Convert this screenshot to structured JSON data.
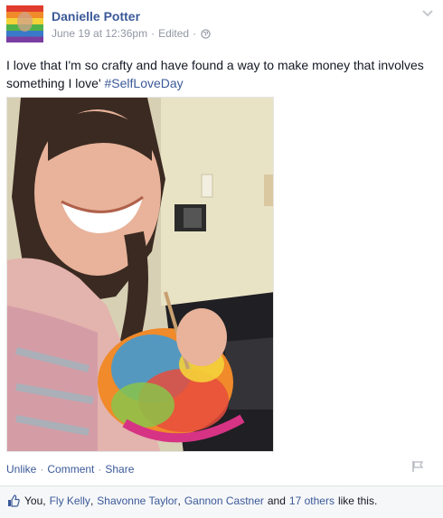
{
  "post": {
    "author": "Danielle Potter",
    "date": "June 19 at 12:36pm",
    "separator": "·",
    "edited": "Edited",
    "message": "I love that I'm so crafty and have found a way to make money that involves something I love'",
    "hashtag": "#SelfLoveDay"
  },
  "actions": {
    "unlike": "Unlike",
    "comment": "Comment",
    "share": "Share",
    "dot": "·"
  },
  "likes": {
    "you": "You",
    "comma1": ",",
    "name1": "Fly Kelly",
    "comma2": ",",
    "name2": "Shavonne Taylor",
    "comma3": ",",
    "name3": "Gannon Castner",
    "and": "and",
    "others": "17 others",
    "suffix": "like this."
  },
  "colors": {
    "link": "#3b5998",
    "meta": "#9197a3",
    "text": "#141823",
    "likes_bg": "#f6f7f9"
  },
  "icons": {
    "audience": "globe-icon",
    "menu": "chevron-down-icon",
    "report": "flag-icon",
    "like": "thumbs-up-icon"
  }
}
